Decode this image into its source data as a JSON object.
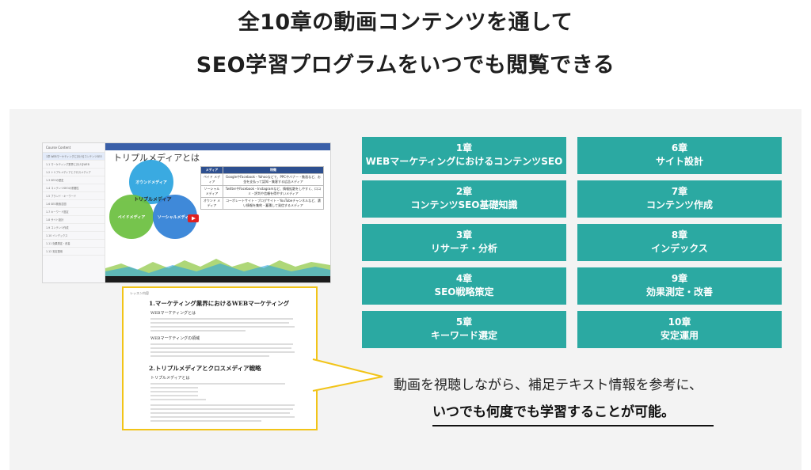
{
  "headline": {
    "line1": "全10章の動画コンテンツを通して",
    "line2": "SEO学習プログラムをいつでも閲覧できる"
  },
  "mockup": {
    "sidebar_title": "Course Content",
    "sidebar_items": [
      "1章 WEBマーケティングにおけるコンテンツSEO",
      "1-1 マーケティング業界におけるWEB",
      "1-2 トリプルメディアとクロスメディア",
      "1-3 SEOの歴史",
      "1-4 コンテンツSEOの重要性",
      "1-5 ブランド・キーワード",
      "1-6 SEO検索意図",
      "1-7 キーワード選定",
      "1-8 サイト設計",
      "1-9 コンテンツ作成",
      "1-10 インデックス",
      "1-11 効果測定・改善",
      "1-12 安定運用"
    ],
    "slide_title": "トリプルメディアとは",
    "venn": {
      "owned": "オウンドメディア",
      "paid": "ペイドメディア",
      "social": "ソーシャルメディア",
      "center": "トリプルメディア"
    },
    "table": {
      "col1": "メディア",
      "col2": "特徴",
      "rows": [
        {
          "name": "ペイド メディア",
          "desc": "GoogleやFacebook・Yahooなどで、PPCやバナー・動画など、お金を支払って認知・集客する広告メディア"
        },
        {
          "name": "ソーシャル メディア",
          "desc": "TwitterやFacebook・Instagramなど、情報拡散をしやすく、口コミ・評判や信頼を得やすいメディア"
        },
        {
          "name": "オウンド メディア",
          "desc": "コーポレートサイト・ブログサイト・YouTubeチャンネルなど、濃い情報を集約・蓄積して発信するメディア"
        }
      ]
    }
  },
  "doc": {
    "label": "レッスン内容",
    "h1": "1.マーケティング業界におけるWEBマーケティング",
    "h1_sub1": "WEBマーケティングとは",
    "h1_sub2": "WEBマーケティングの領域",
    "h2": "2.トリプルメディアとクロスメディア戦略",
    "h2_sub1": "トリプルメディアとは"
  },
  "chapters": [
    {
      "num": "1章",
      "title": "WEBマーケティングにおけるコンテンツSEO"
    },
    {
      "num": "2章",
      "title": "コンテンツSEO基礎知識"
    },
    {
      "num": "3章",
      "title": "リサーチ・分析"
    },
    {
      "num": "4章",
      "title": "SEO戦略策定"
    },
    {
      "num": "5章",
      "title": "キーワード選定"
    },
    {
      "num": "6章",
      "title": "サイト設計"
    },
    {
      "num": "7章",
      "title": "コンテンツ作成"
    },
    {
      "num": "8章",
      "title": "インデックス"
    },
    {
      "num": "9章",
      "title": "効果測定・改善"
    },
    {
      "num": "10章",
      "title": "安定運用"
    }
  ],
  "description": {
    "line1": "動画を視聴しながら、補足テキスト情報を参考に、",
    "line2": "いつでも何度でも学習することが可能。"
  },
  "colors": {
    "teal": "#2ba9a2",
    "yellow": "#f2c418",
    "panel": "#f3f3f3"
  }
}
